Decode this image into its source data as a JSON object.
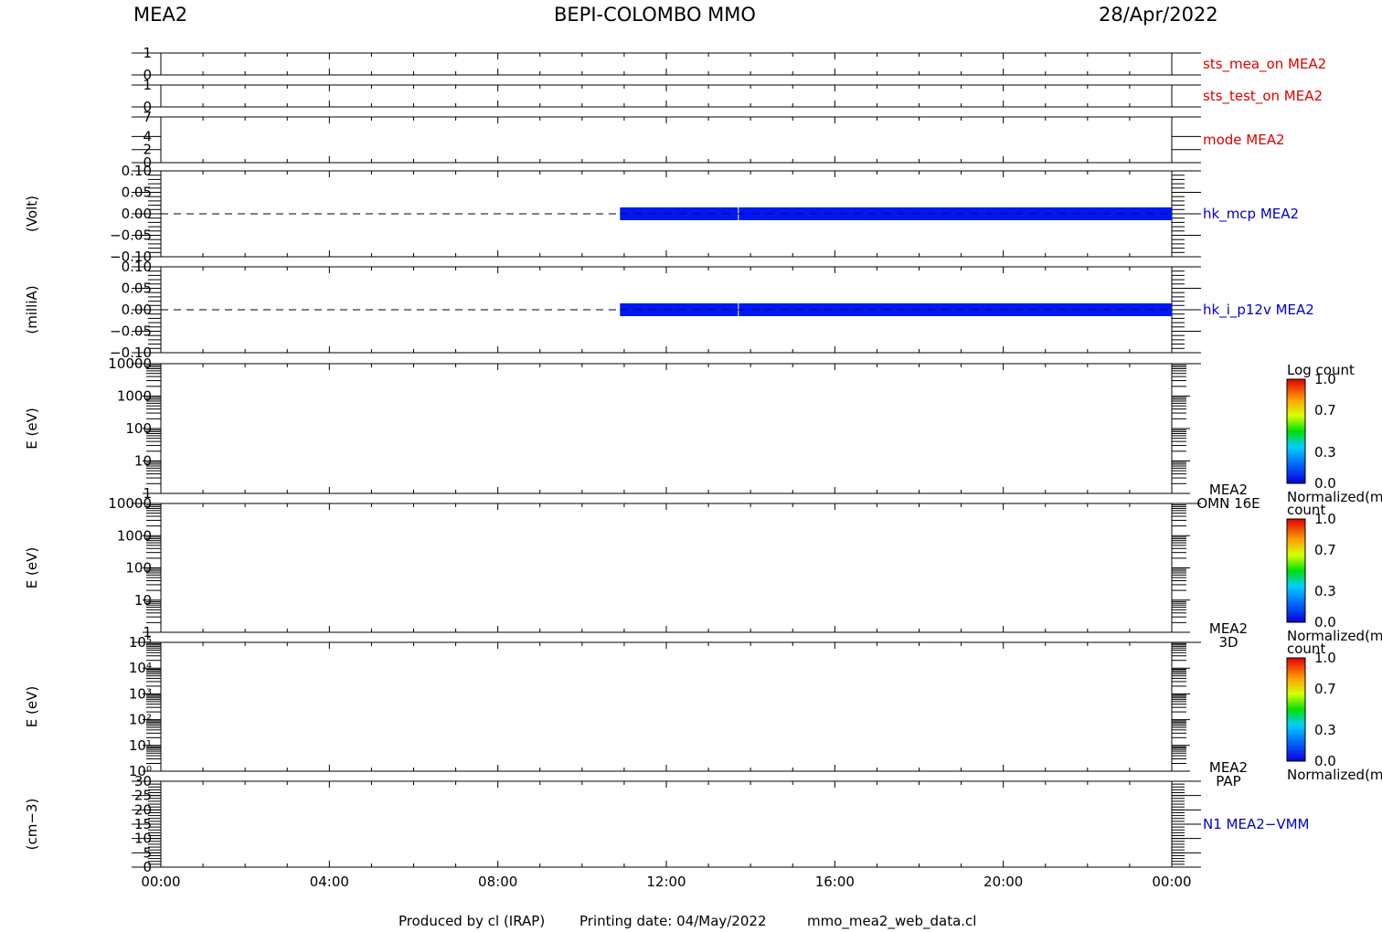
{
  "header": {
    "instrument": "MEA2",
    "mission": "BEPI-COLOMBO MMO",
    "date": "28/Apr/2022"
  },
  "footer": {
    "produced": "Produced by cl (IRAP)",
    "printing": "Printing date: 04/May/2022",
    "file": "mmo_mea2_web_data.cl"
  },
  "colors": {
    "data_bar": "#0018f0",
    "label_red": "#dd0000",
    "label_blue": "#0000cc"
  },
  "chart_data": {
    "type": "line",
    "x_axis": {
      "tick_labels": [
        "00:00",
        "04:00",
        "08:00",
        "12:00",
        "16:00",
        "20:00",
        "00:00"
      ],
      "range_hours": [
        0,
        24
      ]
    },
    "panels": [
      {
        "id": "sts_mea_on",
        "label": "sts_mea_on MEA2",
        "label_color": "red",
        "ylabel": "",
        "ylim": [
          0,
          1
        ],
        "ticks": [
          "1",
          "0"
        ]
      },
      {
        "id": "sts_test_on",
        "label": "sts_test_on MEA2",
        "label_color": "red",
        "ylabel": "",
        "ylim": [
          0,
          1
        ],
        "ticks": [
          "1",
          "0"
        ]
      },
      {
        "id": "mode",
        "label": "mode MEA2",
        "label_color": "red",
        "ylabel": "",
        "ylim": [
          0,
          7
        ],
        "ticks": [
          "7",
          "4",
          "2",
          "0"
        ]
      },
      {
        "id": "hk_mcp",
        "label": "hk_mcp MEA2",
        "label_color": "blue",
        "ylabel": "(Volt)",
        "ylim": [
          -0.1,
          0.1
        ],
        "ticks": [
          "0.10",
          "0.05",
          "0.00",
          "−0.05",
          "−0.10"
        ],
        "series": [
          {
            "x_hours": [
              10.9,
              24
            ],
            "y": [
              0.0,
              0.0
            ],
            "gap_at_hours": 13.7
          }
        ]
      },
      {
        "id": "hk_i_p12v",
        "label": "hk_i_p12v MEA2",
        "label_color": "blue",
        "ylabel": "(milliA)",
        "ylim": [
          -0.1,
          0.1
        ],
        "ticks": [
          "0.10",
          "0.05",
          "0.00",
          "−0.05",
          "−0.10"
        ],
        "series": [
          {
            "x_hours": [
              10.9,
              24
            ],
            "y": [
              0.0,
              0.0
            ],
            "gap_at_hours": 13.7
          }
        ]
      },
      {
        "id": "omn16e",
        "label": [
          "MEA2",
          "OMN 16E"
        ],
        "ylabel": "E (eV)",
        "log": true,
        "ylim": [
          1,
          10000
        ],
        "ticks": [
          "10000",
          "1000",
          "100",
          "10",
          "1"
        ],
        "colorbar": {
          "title": "Log count",
          "ticks": [
            "1.0",
            "0.7",
            "0.3",
            "0.0"
          ],
          "footer": "Normalized(m"
        }
      },
      {
        "id": "3d",
        "label": [
          "MEA2",
          "3D"
        ],
        "ylabel": "E (eV)",
        "log": true,
        "ylim": [
          1,
          10000
        ],
        "ticks": [
          "10000",
          "1000",
          "100",
          "10",
          "1"
        ],
        "colorbar": {
          "title": "count",
          "ticks": [
            "1.0",
            "0.7",
            "0.3",
            "0.0"
          ],
          "footer": "Normalized(m"
        }
      },
      {
        "id": "pap",
        "label": [
          "MEA2",
          "PAP"
        ],
        "ylabel": "E (eV)",
        "log": true,
        "ylim": [
          1,
          100000
        ],
        "ticks": [
          "10⁵",
          "10⁴",
          "10³",
          "10²",
          "10¹",
          "10⁰"
        ],
        "colorbar": {
          "title": "count",
          "ticks": [
            "1.0",
            "0.7",
            "0.3",
            "0.0"
          ],
          "footer": "Normalized(m"
        }
      },
      {
        "id": "n1",
        "label": "N1 MEA2−VMM",
        "label_color": "blue",
        "ylabel": "(cm−3)",
        "ylim": [
          0,
          30
        ],
        "ticks": [
          "30",
          "25",
          "20",
          "15",
          "10",
          "5",
          "0"
        ]
      }
    ]
  }
}
